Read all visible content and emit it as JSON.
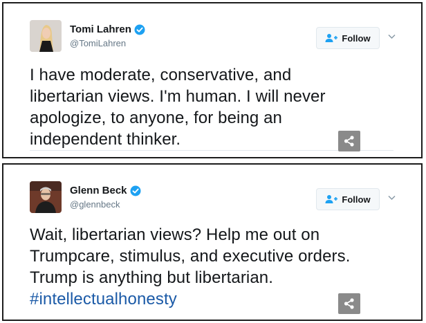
{
  "tweets": [
    {
      "display_name": "Tomi Lahren",
      "handle": "@TomiLahren",
      "follow_label": "Follow",
      "text_lines": [
        "I have moderate, conservative, and",
        "libertarian views. I'm human. I will never",
        "apologize, to anyone, for being an",
        "independent thinker."
      ],
      "hashtag": ""
    },
    {
      "display_name": "Glenn Beck",
      "handle": "@glennbeck",
      "follow_label": "Follow",
      "text_lines": [
        "Wait, libertarian views? Help me out on",
        "Trumpcare, stimulus, and executive orders.",
        "Trump is anything but libertarian."
      ],
      "hashtag": "#intellectualhonesty"
    }
  ],
  "icons": {
    "verified": "verified-badge-icon",
    "follow": "add-user-icon",
    "menu": "chevron-down-icon",
    "share": "share-icon"
  },
  "colors": {
    "verified": "#1da1f2",
    "follow_icon": "#1da1f2",
    "hashtag": "#1b5aa7",
    "share_bg": "#8a8a8a"
  }
}
